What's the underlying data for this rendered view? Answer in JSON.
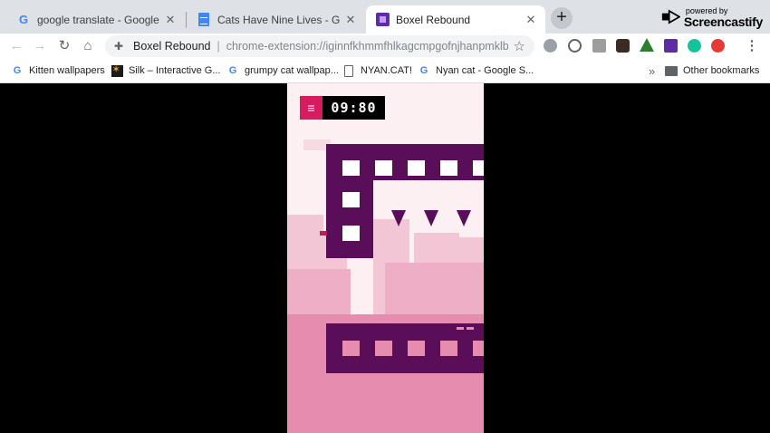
{
  "tabs": [
    {
      "title": "google translate - Google Search",
      "favicon": "google-icon",
      "active": false
    },
    {
      "title": "Cats Have Nine Lives - Google Do",
      "favicon": "google-docs-icon",
      "active": false
    },
    {
      "title": "Boxel Rebound",
      "favicon": "boxel-rebound-icon",
      "active": true
    }
  ],
  "watermark": {
    "small": "powered by",
    "big": "Screencastify"
  },
  "omnibox": {
    "site": "Boxel Rebound",
    "url": "chrome-extension://iginnfkhmmfhlkagcmpgofnjhanpmklb/..."
  },
  "bookmarks": [
    {
      "label": "Kitten wallpapers",
      "icon": "google-icon"
    },
    {
      "label": "Silk – Interactive G...",
      "icon": "silk-icon"
    },
    {
      "label": "grumpy cat wallpap...",
      "icon": "google-icon"
    },
    {
      "label": "NYAN.CAT!",
      "icon": "page-icon"
    },
    {
      "label": "Nyan cat - Google S...",
      "icon": "google-icon"
    }
  ],
  "other_bookmarks": "Other bookmarks",
  "overflow_chevron": "»",
  "game": {
    "menu_icon": "≡",
    "timer": "09:80"
  },
  "colors": {
    "platform": "#5a0e5a",
    "menu_button": "#d81b60",
    "ground": "#e58caf"
  }
}
